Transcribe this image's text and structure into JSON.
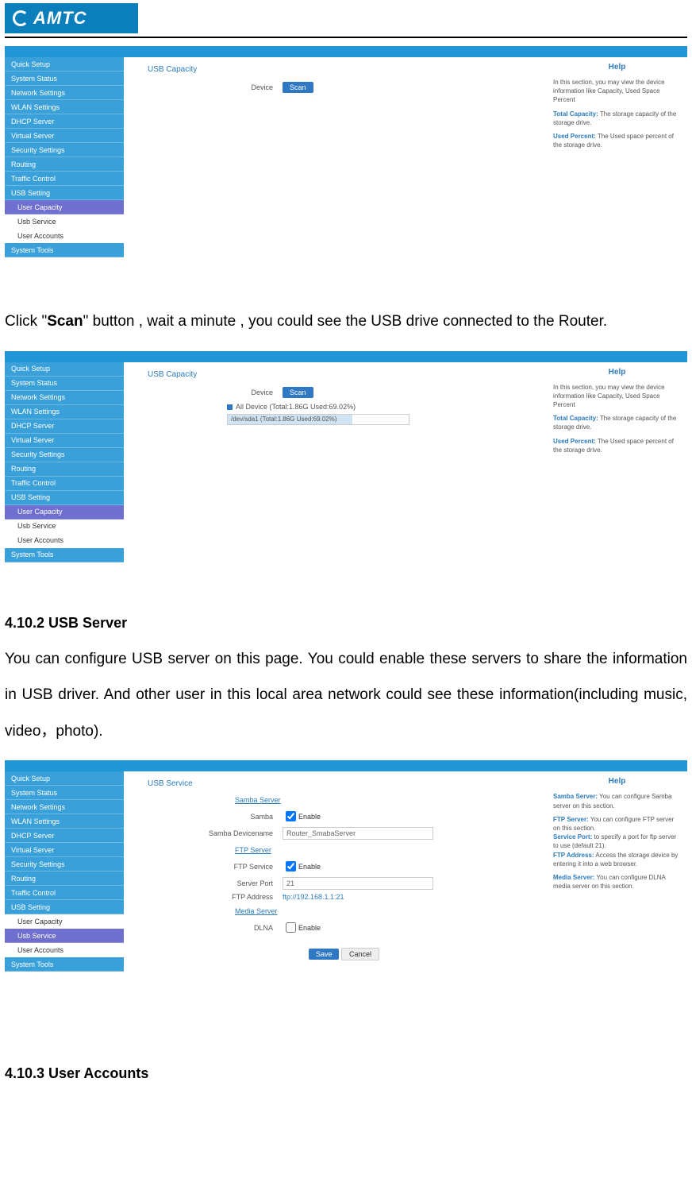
{
  "logo_text": "AMTC",
  "sidebar_items": [
    "Quick Setup",
    "System Status",
    "Network Settings",
    "WLAN Settings",
    "DHCP Server",
    "Virtual Server",
    "Security Settings",
    "Routing",
    "Traffic Control",
    "USB Setting"
  ],
  "sidebar_sub": {
    "usb_capacity": "User Capacity",
    "usb_service": "Usb Service",
    "user_accounts": "User Accounts"
  },
  "sidebar_last": "System Tools",
  "fig1": {
    "panel_title": "USB Capacity",
    "device_label": "Device",
    "scan_btn": "Scan",
    "help": {
      "title": "Help",
      "intro": "In this section, you may view the device information like Capacity, Used Space Percent",
      "total_capacity_term": "Total Capacity:",
      "total_capacity_text": " The storage capacity of the storage drive.",
      "used_percent_term": "Used Percent:",
      "used_percent_text": " The Used space percent of the storage drive."
    }
  },
  "para1_pre": "Click  \"",
  "para1_scan": "Scan",
  "para1_post": "\"  button , wait a minute , you could see the USB drive connected to the Router.",
  "fig2": {
    "panel_title": "USB Capacity",
    "device_label": "Device",
    "scan_btn": "Scan",
    "all_device_line": "All Device  (Total:1.86G    Used:69.02%)",
    "dev1_line": "/dev/sda1  (Total:1.86G    Used:69.02%)",
    "bar_width": "69.02%",
    "help": {
      "title": "Help",
      "intro": "In this section, you may view the device information like Capacity, Used Space Percent",
      "total_capacity_term": "Total Capacity:",
      "total_capacity_text": " The storage capacity of the storage drive.",
      "used_percent_term": "Used Percent:",
      "used_percent_text": " The Used space percent of the storage drive."
    }
  },
  "h_usb_server": "4.10.2 USB Server",
  "para2": "You can configure USB server on this page. You could enable these servers to share the information in USB driver. And other user in this local area network could see these information(including music, video，photo).",
  "fig3": {
    "panel_title": "USB Service",
    "samba_server": "Samba Server",
    "samba_lbl": "Samba",
    "enable": "Enable",
    "samba_dev_lbl": "Samba Devicename",
    "samba_dev_val": "Router_SmabaServer",
    "ftp_server": "FTP Server",
    "ftp_service_lbl": "FTP Service",
    "server_port_lbl": "Server Port",
    "server_port_val": "21",
    "ftp_addr_lbl": "FTP Address",
    "ftp_addr_val": "ftp://192.168.1.1:21",
    "media_server": "Media Server",
    "dlna_lbl": "DLNA",
    "save_btn": "Save",
    "cancel_btn": "Cancel",
    "help": {
      "title": "Help",
      "samba_term": "Samba Server:",
      "samba_text": " You can configure Samba server on this section.",
      "ftp_term": "FTP Server:",
      "ftp_text": " You can configure FTP server on this section.",
      "svc_port_term": "Service Port:",
      "svc_port_text": " to specify a port for ftp server to use (default 21).",
      "ftp_addr_term": "FTP Address:",
      "ftp_addr_text": " Access the storage device by entering it into a web browser.",
      "media_term": "Media Server:",
      "media_text": " You can configure DLNA media server on this section."
    }
  },
  "h_user_accounts": "4.10.3 User Accounts"
}
